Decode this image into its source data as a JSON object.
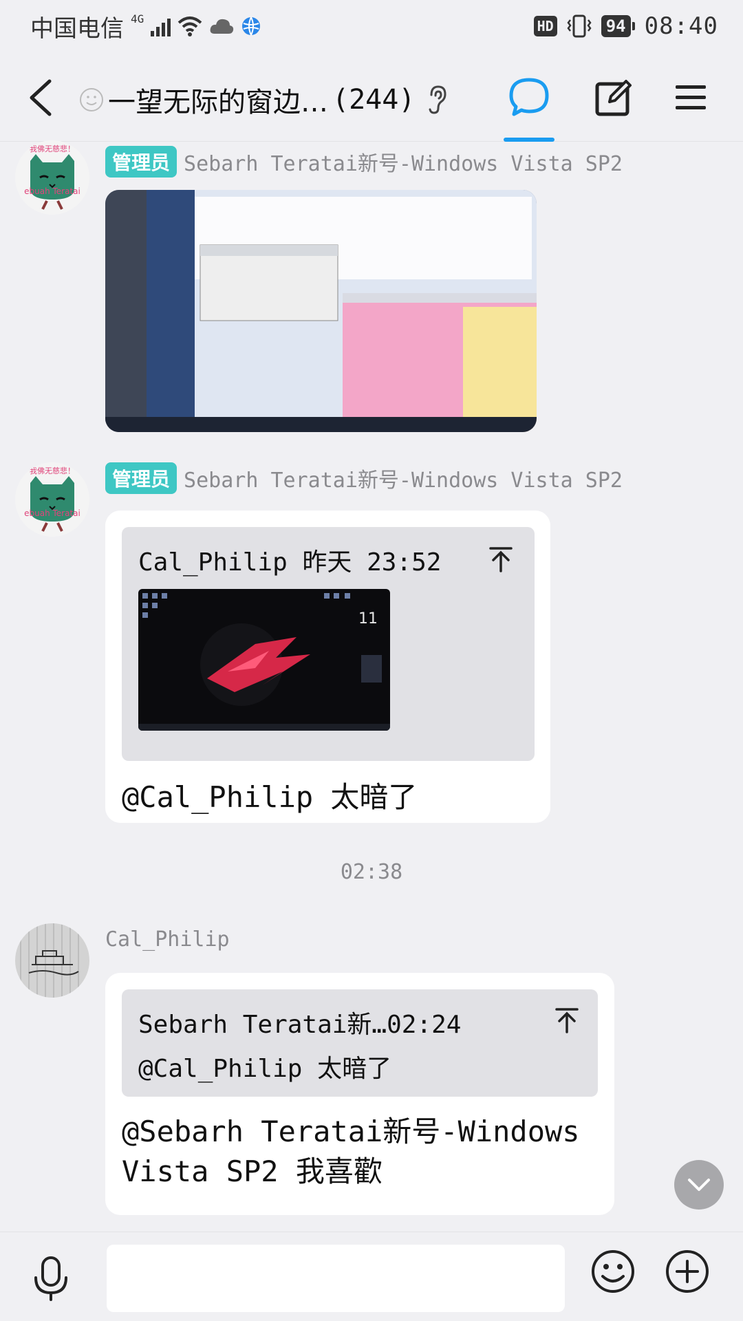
{
  "status_bar": {
    "carrier": "中国电信",
    "network": "4G",
    "hd_label": "HD",
    "battery": "94",
    "time": "08:40"
  },
  "header": {
    "title": "一望无际的窗边…",
    "member_count": "(244)",
    "active_tab_color": "#1a9cf0"
  },
  "messages": [
    {
      "role_badge": "管理员",
      "sender": "Sebarh Teratai新号-Windows Vista SP2",
      "type": "image",
      "image_desc": "screenshot-image"
    },
    {
      "role_badge": "管理员",
      "sender": "Sebarh Teratai新号-Windows Vista SP2",
      "type": "reply",
      "quote": {
        "author_time": "Cal_Philip 昨天 23:52"
      },
      "text": "@Cal_Philip 太暗了"
    },
    {
      "sender": "Cal_Philip",
      "type": "reply",
      "quote": {
        "author_time": "Sebarh Teratai新…02:24",
        "text": "@Cal_Philip 太暗了"
      },
      "text": "@Sebarh Teratai新号-Windows Vista SP2 我喜歡"
    }
  ],
  "timestamp": "02:38",
  "input": {
    "placeholder": ""
  },
  "colors": {
    "admin_badge": "#3ec7c4",
    "background": "#f0f0f3"
  }
}
